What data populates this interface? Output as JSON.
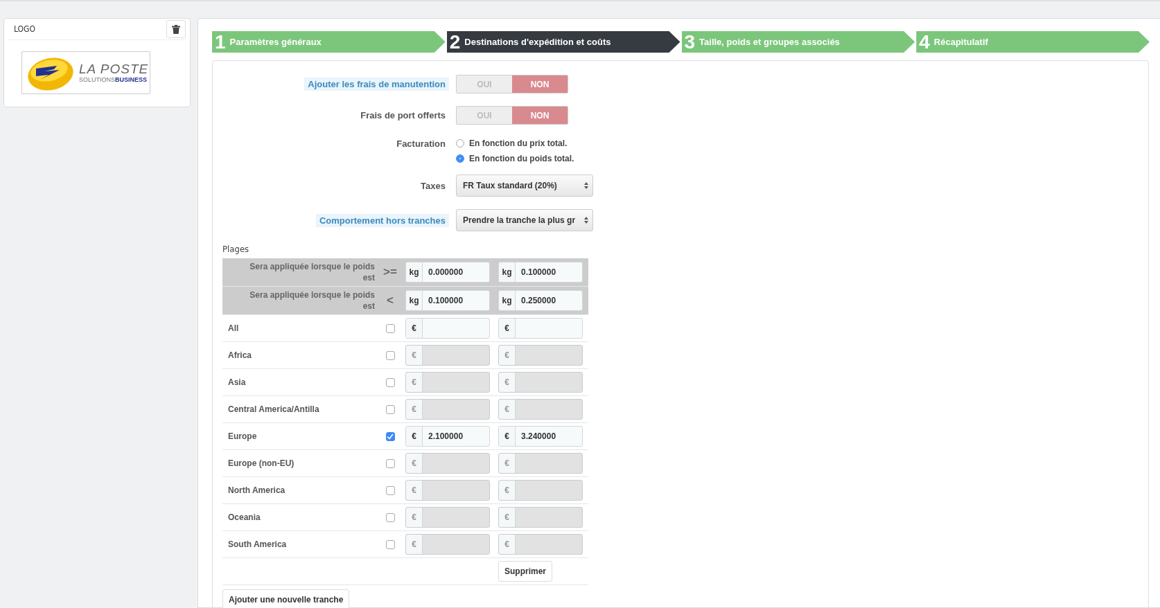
{
  "logo_panel": {
    "title": "LOGO",
    "logo": {
      "name": "LA POSTE",
      "tagline_1": "SOLUTIONS",
      "tagline_2": "BUSINESS"
    }
  },
  "steps": [
    {
      "number": "1",
      "label": "Paramètres généraux",
      "selected": false
    },
    {
      "number": "2",
      "label": "Destinations d'expédition et coûts",
      "selected": true
    },
    {
      "number": "3",
      "label": "Taille, poids et groupes associés",
      "selected": false
    },
    {
      "number": "4",
      "label": "Récapitulatif",
      "selected": false
    }
  ],
  "form": {
    "toggles": [
      {
        "label": "Ajouter les frais de manutention",
        "highlighted": true,
        "yes": "OUI",
        "no": "NON",
        "on": false
      },
      {
        "label": "Frais de port offerts",
        "highlighted": false,
        "yes": "OUI",
        "no": "NON",
        "on": false
      }
    ],
    "billing": {
      "label": "Facturation",
      "options": [
        {
          "label": "En fonction du prix total.",
          "selected": false
        },
        {
          "label": "En fonction du poids total.",
          "selected": true
        }
      ]
    },
    "selects": [
      {
        "label": "Taxes",
        "highlighted": false,
        "value": "FR Taux standard (20%)"
      },
      {
        "label": "Comportement hors tranches",
        "highlighted": true,
        "value": "Prendre la tranche la plus gr"
      }
    ]
  },
  "ranges": {
    "title": "Plages",
    "bounds": [
      {
        "label": "Sera appliquée lorsque le poids est",
        "operator": ">=",
        "cells": [
          {
            "unit": "kg",
            "value": "0.000000"
          },
          {
            "unit": "kg",
            "value": "0.100000"
          }
        ]
      },
      {
        "label": "Sera appliquée lorsque le poids est",
        "operator": "<",
        "cells": [
          {
            "unit": "kg",
            "value": "0.100000"
          },
          {
            "unit": "kg",
            "value": "0.250000"
          }
        ]
      }
    ],
    "zones": [
      {
        "name": "All",
        "checked": false,
        "disabled": false,
        "cells": [
          {
            "currency": "€"
          },
          {
            "currency": "€"
          }
        ]
      },
      {
        "name": "Africa",
        "checked": false,
        "disabled": true,
        "cells": [
          {
            "currency": "€"
          },
          {
            "currency": "€"
          }
        ]
      },
      {
        "name": "Asia",
        "checked": false,
        "disabled": true,
        "cells": [
          {
            "currency": "€"
          },
          {
            "currency": "€"
          }
        ]
      },
      {
        "name": "Central America/Antilla",
        "checked": false,
        "disabled": true,
        "cells": [
          {
            "currency": "€"
          },
          {
            "currency": "€"
          }
        ]
      },
      {
        "name": "Europe",
        "checked": true,
        "disabled": false,
        "cells": [
          {
            "currency": "€",
            "value": "2.100000"
          },
          {
            "currency": "€",
            "value": "3.240000"
          }
        ]
      },
      {
        "name": "Europe (non-EU)",
        "checked": false,
        "disabled": true,
        "cells": [
          {
            "currency": "€"
          },
          {
            "currency": "€"
          }
        ]
      },
      {
        "name": "North America",
        "checked": false,
        "disabled": true,
        "cells": [
          {
            "currency": "€"
          },
          {
            "currency": "€"
          }
        ]
      },
      {
        "name": "Oceania",
        "checked": false,
        "disabled": true,
        "cells": [
          {
            "currency": "€"
          },
          {
            "currency": "€"
          }
        ]
      },
      {
        "name": "South America",
        "checked": false,
        "disabled": true,
        "cells": [
          {
            "currency": "€"
          },
          {
            "currency": "€"
          }
        ]
      }
    ],
    "delete_button": "Supprimer",
    "add_button": "Ajouter une nouvelle tranche"
  }
}
